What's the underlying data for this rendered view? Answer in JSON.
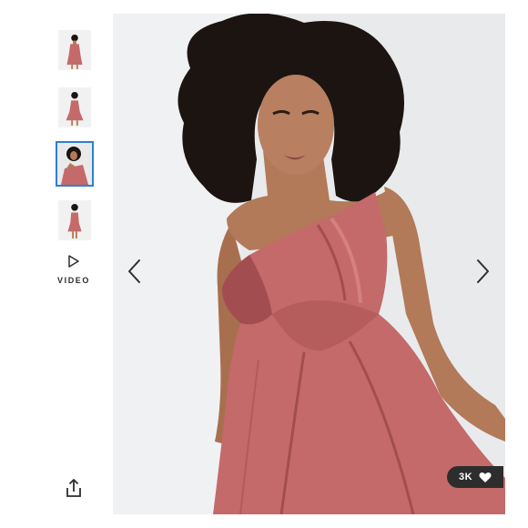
{
  "gallery": {
    "thumbnails": [
      {
        "alt": "thumbnail-1",
        "active": false
      },
      {
        "alt": "thumbnail-2",
        "active": false
      },
      {
        "alt": "thumbnail-3",
        "active": true
      },
      {
        "alt": "thumbnail-4",
        "active": false
      }
    ],
    "video_label": "VIDEO",
    "likes_count": "3K"
  },
  "colors": {
    "dress": "#c46a6a",
    "dress_shadow": "#a24e50",
    "skin": "#b27a58",
    "hair": "#1b1411",
    "background": "#e9eaec",
    "active_border": "#2d7fd6",
    "pill": "#2d2d2d"
  },
  "icons": {
    "play": "play-icon",
    "share": "share-icon",
    "prev": "chevron-left-icon",
    "next": "chevron-right-icon",
    "heart": "heart-icon"
  }
}
